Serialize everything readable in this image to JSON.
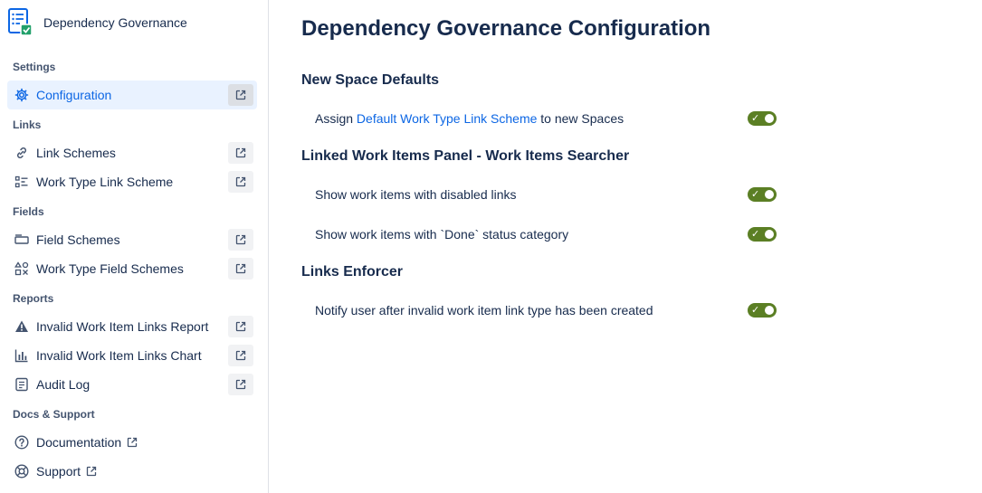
{
  "app": {
    "title": "Dependency Governance"
  },
  "sidebar": {
    "sections": {
      "settings": "Settings",
      "links": "Links",
      "fields": "Fields",
      "reports": "Reports",
      "docs": "Docs & Support"
    },
    "items": {
      "configuration": "Configuration",
      "link_schemes": "Link Schemes",
      "work_type_link_scheme": "Work Type Link Scheme",
      "field_schemes": "Field Schemes",
      "work_type_field_schemes": "Work Type Field Schemes",
      "invalid_links_report": "Invalid Work Item Links Report",
      "invalid_links_chart": "Invalid Work Item Links Chart",
      "audit_log": "Audit Log",
      "documentation": "Documentation",
      "support": "Support"
    }
  },
  "main": {
    "title": "Dependency Governance Configuration",
    "sections": {
      "new_space": {
        "title": "New Space Defaults",
        "assign_prefix": "Assign",
        "assign_link": "Default Work Type Link Scheme",
        "assign_suffix": "to new Spaces"
      },
      "panel": {
        "title": "Linked Work Items Panel - Work Items Searcher",
        "disabled_links": "Show work items with disabled links",
        "done_status": "Show work items with `Done` status category"
      },
      "enforcer": {
        "title": "Links Enforcer",
        "notify": "Notify user after invalid work item link type has been created"
      }
    }
  },
  "colors": {
    "accent": "#0c66e4",
    "toggle_on": "#5b7f24",
    "active_bg": "#e9f2ff"
  }
}
